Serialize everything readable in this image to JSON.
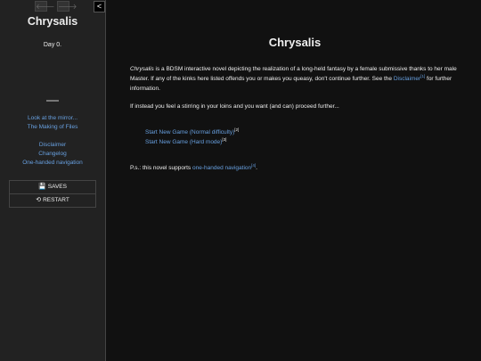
{
  "sidebar": {
    "history_back": "🡐",
    "history_forward": "🡒",
    "toggle": "<",
    "title": "Chrysalis",
    "day": "Day 0.",
    "menu_primary": [
      "Look at the mirror...",
      "The Making of Files"
    ],
    "menu_secondary": [
      "Disclaimer",
      "Changelog",
      "One-handed navigation"
    ],
    "saves_label": "SAVES",
    "restart_label": "RESTART",
    "saves_icon": "💾",
    "restart_icon": "⟲"
  },
  "passage": {
    "title": "Chrysalis",
    "intro_em": "Chrysalis",
    "intro_text": " is a BDSM interactive novel depicting the realization of a long-held fantasy by a female submissive thanks to her male Master. If any of the kinks here listed offends you or makes you queasy, don't continue further. See the ",
    "intro_link": "Disclaimer",
    "intro_ref": "[1]",
    "intro_tail": " for further information.",
    "stirring": "If instead you feel a stirring in your loins and you want (and can) proceed further...",
    "start_normal": "Start New Game (Normal difficulty)",
    "start_normal_ref": "[2]",
    "start_hard": "Start New Game (Hard mode)",
    "start_hard_ref": "[3]",
    "ps_text": "P.s.: this novel supports ",
    "ps_link": "one-handed navigation",
    "ps_ref": "[4]",
    "ps_end": "."
  },
  "colors": {
    "link": "#68a0e0",
    "sidebar_bg": "#222222",
    "page_bg": "#111111"
  }
}
